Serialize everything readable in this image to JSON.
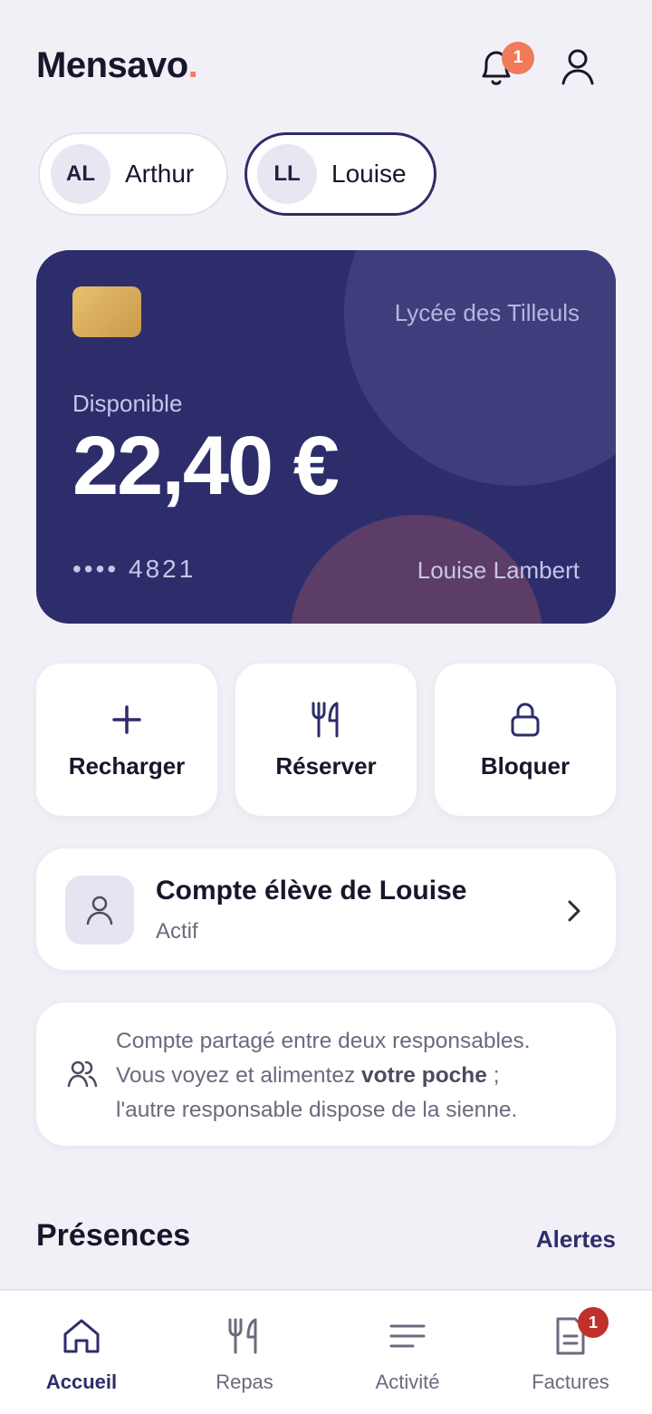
{
  "app": {
    "brand": "Mensavo",
    "brand_dot": ".",
    "notifications_count": "1"
  },
  "children": [
    {
      "initials": "AL",
      "name": "Arthur",
      "selected": false
    },
    {
      "initials": "LL",
      "name": "Louise",
      "selected": true
    }
  ],
  "card": {
    "school": "Lycée des Tilleuls",
    "available_label": "Disponible",
    "amount": "22,40 €",
    "number": "•••• 4821",
    "holder": "Louise Lambert"
  },
  "actions": [
    {
      "label": "Recharger",
      "icon": "plus-icon"
    },
    {
      "label": "Réserver",
      "icon": "fork-knife-icon"
    },
    {
      "label": "Bloquer",
      "icon": "lock-icon"
    }
  ],
  "account": {
    "title": "Compte élève de Louise",
    "status": "Actif"
  },
  "info": {
    "line1": "Compte partagé entre deux responsables.",
    "line2_pre": "Vous voyez et alimentez ",
    "line2_bold": "votre poche",
    "line2_post": " ;",
    "line3": "l'autre responsable dispose de la sienne."
  },
  "section": {
    "heading": "Présences",
    "link": "Alertes"
  },
  "tabs": [
    {
      "label": "Accueil",
      "icon": "home-icon",
      "active": true
    },
    {
      "label": "Repas",
      "icon": "fork-knife-icon",
      "active": false
    },
    {
      "label": "Activité",
      "icon": "list-icon",
      "active": false
    },
    {
      "label": "Factures",
      "icon": "document-icon",
      "active": false,
      "badge": "1"
    }
  ],
  "colors": {
    "background": "#f1f0f6",
    "primary": "#2d2d6b",
    "accent": "#f07a5a",
    "badge_red": "#c0302c"
  }
}
